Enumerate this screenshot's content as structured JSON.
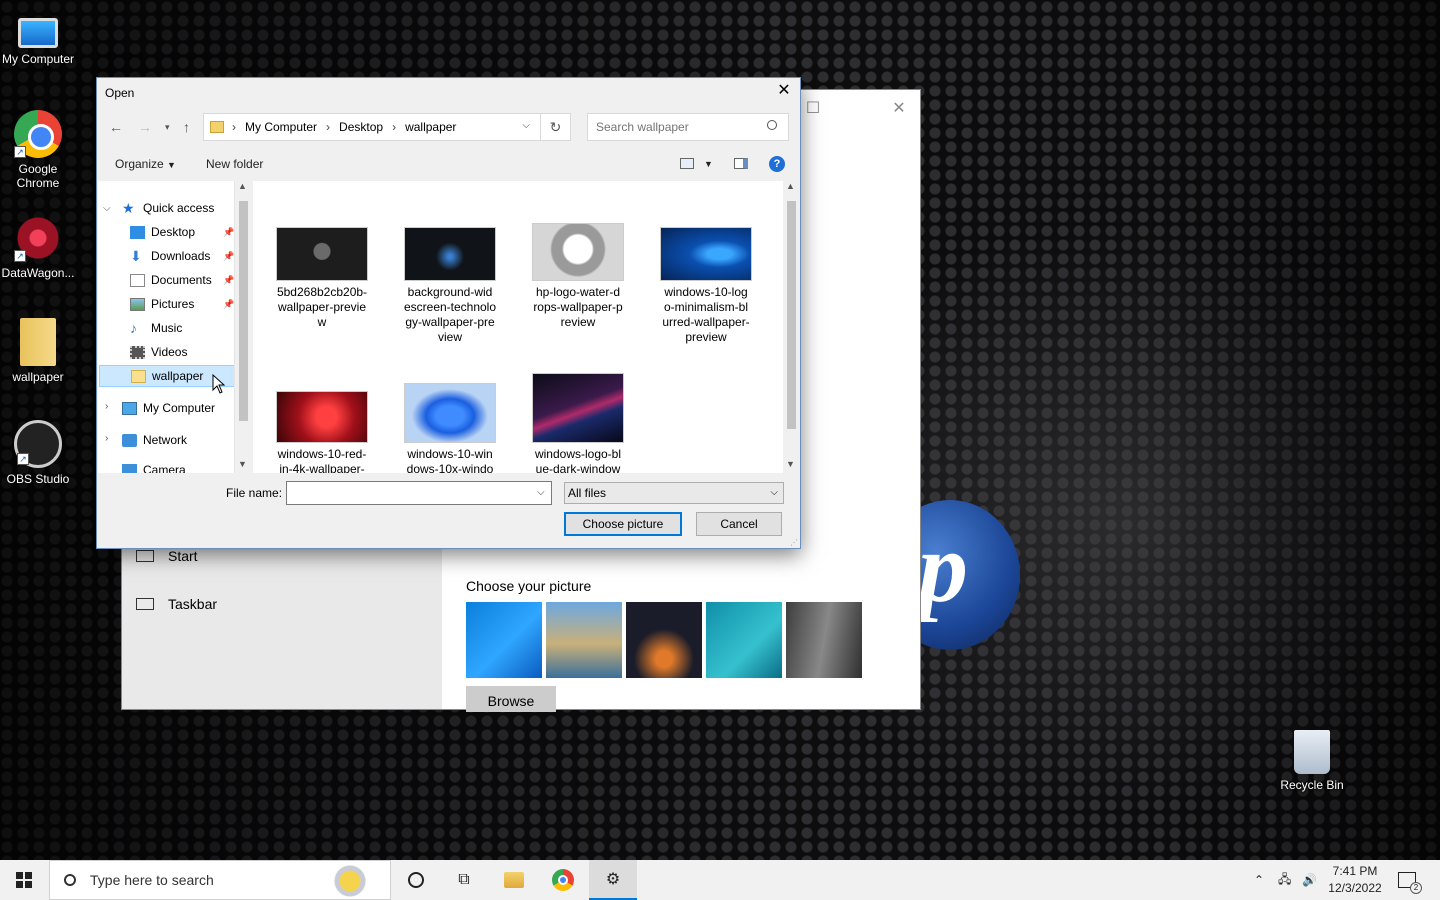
{
  "desktop": {
    "icons": [
      {
        "label": "My Computer",
        "icon": "computer-icon"
      },
      {
        "label": "Google Chrome",
        "icon": "chrome-icon"
      },
      {
        "label": "DataWagon...",
        "icon": "datawagon-icon"
      },
      {
        "label": "wallpaper",
        "icon": "folder-icon"
      },
      {
        "label": "OBS Studio",
        "icon": "obs-icon"
      },
      {
        "label": "Recycle Bin",
        "icon": "recycle-bin-icon"
      }
    ]
  },
  "settings": {
    "nav": [
      {
        "label": "Start",
        "icon": "start-icon"
      },
      {
        "label": "Taskbar",
        "icon": "taskbar-icon"
      }
    ],
    "choose_label": "Choose your picture",
    "browse_label": "Browse"
  },
  "dialog": {
    "title": "Open",
    "breadcrumb": [
      "My Computer",
      "Desktop",
      "wallpaper"
    ],
    "search_placeholder": "Search wallpaper",
    "organize_label": "Organize",
    "new_folder_label": "New folder",
    "help_glyph": "?",
    "tree": [
      {
        "label": "Quick access",
        "icon": "star-icon"
      },
      {
        "label": "Desktop",
        "icon": "desktop-folder-icon"
      },
      {
        "label": "Downloads",
        "icon": "download-icon"
      },
      {
        "label": "Documents",
        "icon": "documents-icon"
      },
      {
        "label": "Pictures",
        "icon": "pictures-icon"
      },
      {
        "label": "Music",
        "icon": "music-icon"
      },
      {
        "label": "Videos",
        "icon": "videos-icon"
      },
      {
        "label": "wallpaper",
        "icon": "folder-icon"
      },
      {
        "label": "My Computer",
        "icon": "computer-icon"
      },
      {
        "label": "Network",
        "icon": "network-icon"
      },
      {
        "label": "Camera",
        "icon": "camera-icon"
      }
    ],
    "files": [
      {
        "name": "5bd268b2cb20b-wallpaper-previe w",
        "lines": [
          "5bd268b2cb20b-",
          "wallpaper-previe",
          "w"
        ]
      },
      {
        "name": "background-wid escreen-technolo gy-wallpaper-pre view",
        "lines": [
          "background-wid",
          "escreen-technolo",
          "gy-wallpaper-pre",
          "view"
        ]
      },
      {
        "name": "hp-logo-water-d rops-wallpaper-p review",
        "lines": [
          "hp-logo-water-d",
          "rops-wallpaper-p",
          "review"
        ]
      },
      {
        "name": "windows-10-log o-minimalism-bl urred-wallpaper-preview",
        "lines": [
          "windows-10-log",
          "o-minimalism-bl",
          "urred-wallpaper-",
          "preview"
        ]
      },
      {
        "name": "windows-10-red-in-4k-wallpaper-",
        "lines": [
          "windows-10-red-",
          "in-4k-wallpaper-"
        ]
      },
      {
        "name": "windows-10-win dows-10x-windo",
        "lines": [
          "windows-10-win",
          "dows-10x-windo"
        ]
      },
      {
        "name": "windows-logo-bl ue-dark-window",
        "lines": [
          "windows-logo-bl",
          "ue-dark-window"
        ]
      }
    ],
    "file_name_label": "File name:",
    "file_name_value": "",
    "filter_value": "All files",
    "choose_button": "Choose picture",
    "cancel_button": "Cancel"
  },
  "taskbar": {
    "search_placeholder": "Type here to search",
    "time": "7:41 PM",
    "date": "12/3/2022",
    "notification_count": "2"
  }
}
